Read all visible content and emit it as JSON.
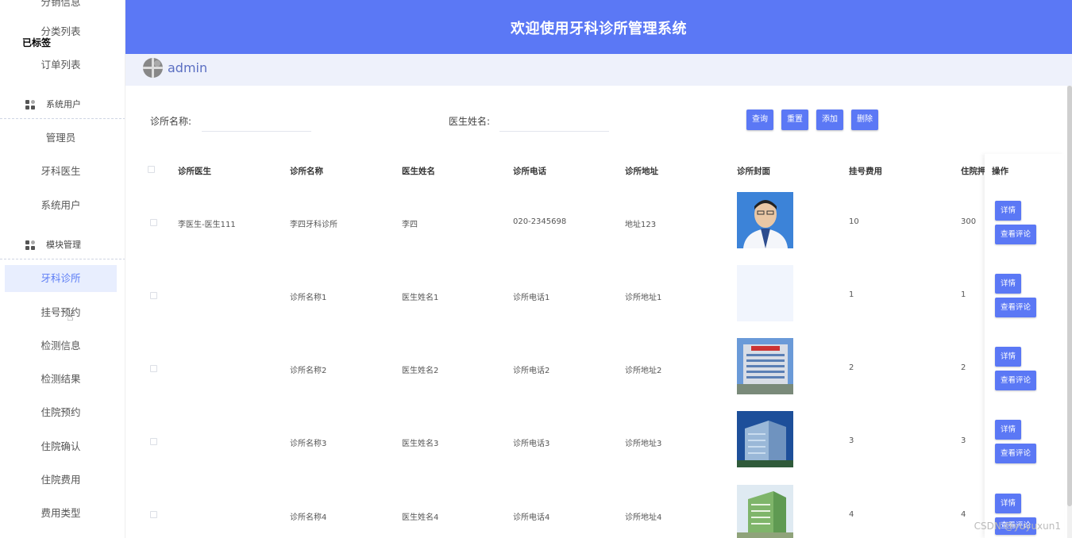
{
  "sidebar": {
    "top_cut": "分销信息",
    "items_top": [
      "分类列表",
      "已标签",
      "订单列表"
    ],
    "group_system": "系统用户",
    "items_system": [
      "管理员",
      "牙科医生",
      "系统用户"
    ],
    "group_module": "模块管理",
    "items_module": [
      "牙科诊所",
      "挂号预约",
      "检测信息",
      "检测结果",
      "住院预约",
      "住院确认",
      "住院费用",
      "费用类型"
    ],
    "active": "牙科诊所"
  },
  "header": {
    "title": "欢迎使用牙科诊所管理系统",
    "username": "admin"
  },
  "search": {
    "clinic_name_label": "诊所名称:",
    "doctor_name_label": "医生姓名:",
    "buttons": {
      "query": "查询",
      "reset": "重置",
      "add": "添加",
      "delete": "删除"
    }
  },
  "table": {
    "columns": [
      "诊所医生",
      "诊所名称",
      "医生姓名",
      "诊所电话",
      "诊所地址",
      "诊所封面",
      "挂号费用",
      "住院押金",
      "操作"
    ],
    "rows": [
      {
        "doctor": "李医生-医生111",
        "name": "李四牙科诊所",
        "doctor_name": "李四",
        "phone": "020-2345698",
        "address": "地址123",
        "cover": "doctor-portrait",
        "fee": "10",
        "deposit": "300"
      },
      {
        "doctor": "",
        "name": "诊所名称1",
        "doctor_name": "医生姓名1",
        "phone": "诊所电话1",
        "address": "诊所地址1",
        "cover": "blank",
        "fee": "1",
        "deposit": "1"
      },
      {
        "doctor": "",
        "name": "诊所名称2",
        "doctor_name": "医生姓名2",
        "phone": "诊所电话2",
        "address": "诊所地址2",
        "cover": "hospital-building",
        "fee": "2",
        "deposit": "2"
      },
      {
        "doctor": "",
        "name": "诊所名称3",
        "doctor_name": "医生姓名3",
        "phone": "诊所电话3",
        "address": "诊所地址3",
        "cover": "hospital-tower",
        "fee": "3",
        "deposit": "3"
      },
      {
        "doctor": "",
        "name": "诊所名称4",
        "doctor_name": "医生姓名4",
        "phone": "诊所电话4",
        "address": "诊所地址4",
        "cover": "hospital-green",
        "fee": "4",
        "deposit": "4"
      }
    ],
    "row_actions": {
      "detail": "详情",
      "review": "查看评论"
    }
  },
  "watermark": "CSDN @yuyuxun1",
  "colors": {
    "primary": "#5b78f5",
    "active_bg": "#e8eefe",
    "userbar_bg": "#eef1fb"
  }
}
